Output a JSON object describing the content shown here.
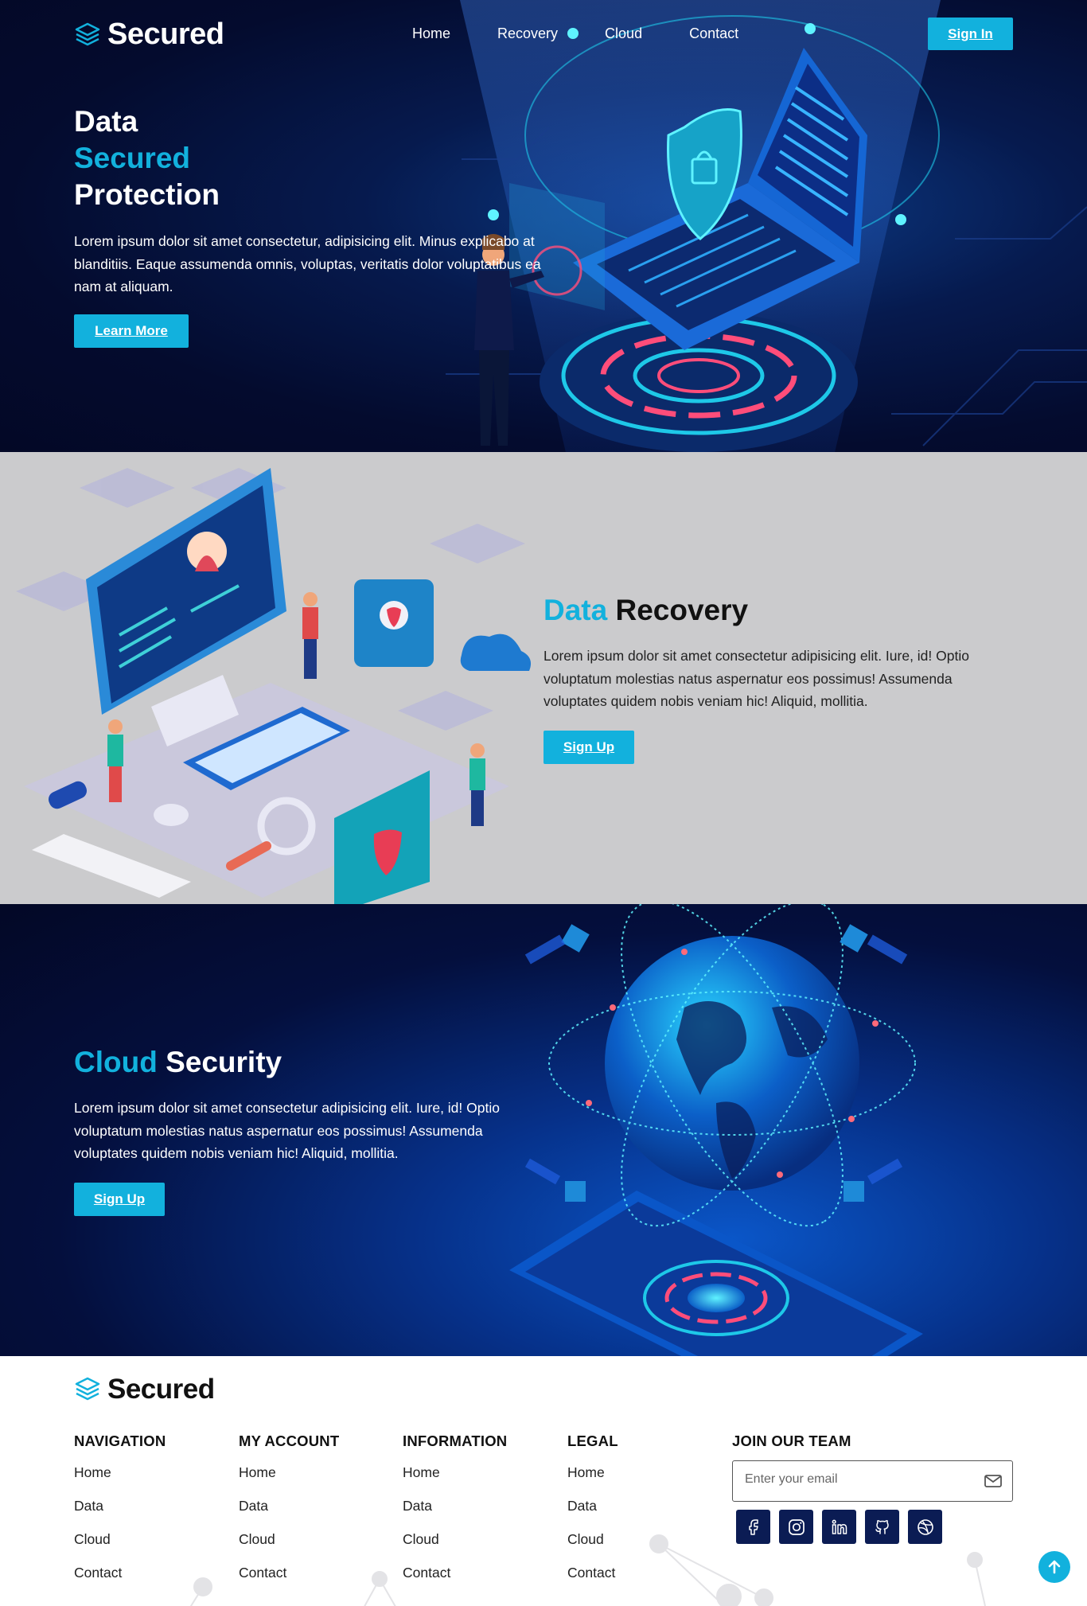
{
  "brand": {
    "name": "Secured",
    "icon": "layers-icon"
  },
  "nav": {
    "items": [
      "Home",
      "Recovery",
      "Cloud",
      "Contact"
    ],
    "signin_label": "Sign In"
  },
  "hero": {
    "title_line1": "Data",
    "title_line2": "Secured",
    "title_line3": "Protection",
    "text": "Lorem ipsum dolor sit amet consectetur, adipisicing elit. Minus explicabo at blanditiis. Eaque assumenda omnis, voluptas, veritatis dolor voluptatibus ea nam at aliquam.",
    "button": "Learn More"
  },
  "recovery": {
    "title_accent": "Data",
    "title_rest": "Recovery",
    "text": "Lorem ipsum dolor sit amet consectetur adipisicing elit. Iure, id! Optio voluptatum molestias natus aspernatur eos possimus! Assumenda voluptates quidem nobis veniam hic! Aliquid, mollitia.",
    "button": "Sign Up"
  },
  "cloud": {
    "title_accent": "Cloud",
    "title_rest": "Security",
    "text": "Lorem ipsum dolor sit amet consectetur adipisicing elit. Iure, id! Optio voluptatum molestias natus aspernatur eos possimus! Assumenda voluptates quidem nobis veniam hic! Aliquid, mollitia.",
    "button": "Sign Up"
  },
  "footer": {
    "columns": [
      {
        "heading": "NAVIGATION",
        "items": [
          "Home",
          "Data",
          "Cloud",
          "Contact"
        ]
      },
      {
        "heading": "MY ACCOUNT",
        "items": [
          "Home",
          "Data",
          "Cloud",
          "Contact"
        ]
      },
      {
        "heading": "INFORMATION",
        "items": [
          "Home",
          "Data",
          "Cloud",
          "Contact"
        ]
      },
      {
        "heading": "LEGAL",
        "items": [
          "Home",
          "Data",
          "Cloud",
          "Contact"
        ]
      }
    ],
    "join": {
      "heading": "JOIN OUR TEAM",
      "email_placeholder": "Enter your email"
    },
    "socials": [
      "facebook-icon",
      "instagram-icon",
      "linkedin-icon",
      "github-icon",
      "dribbble-icon"
    ]
  },
  "colors": {
    "accent": "#12b1dd",
    "dark_navy": "#040b2e",
    "social_bg": "#0b1c54"
  }
}
